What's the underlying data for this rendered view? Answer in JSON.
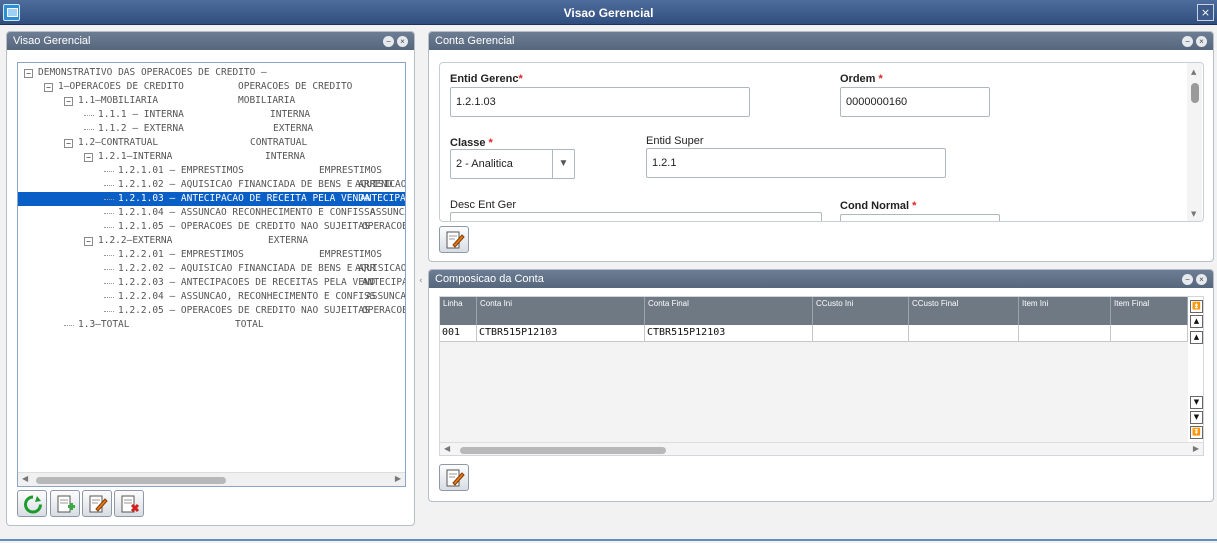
{
  "window": {
    "title": "Visao Gerencial",
    "close_glyph": "×"
  },
  "left_panel": {
    "title": "Visao Gerencial",
    "tree": [
      {
        "label": "DEMONSTRATIVO DAS OPERACOES DE CREDITO –",
        "desc": "",
        "expander": "−"
      },
      {
        "label": "1–OPERACOES DE CREDITO",
        "desc": "OPERACOES DE CREDITO",
        "expander": "−"
      },
      {
        "label": "1.1–MOBILIARIA",
        "desc": "MOBILIARIA",
        "expander": "−"
      },
      {
        "label": "1.1.1 – INTERNA",
        "desc": "INTERNA",
        "expander": ""
      },
      {
        "label": "1.1.2 – EXTERNA",
        "desc": "EXTERNA",
        "expander": ""
      },
      {
        "label": "1.2–CONTRATUAL",
        "desc": "CONTRATUAL",
        "expander": "−"
      },
      {
        "label": "1.2.1–INTERNA",
        "desc": "INTERNA",
        "expander": "−"
      },
      {
        "label": "1.2.1.01 – EMPRESTIMOS",
        "desc": "EMPRESTIMOS",
        "expander": ""
      },
      {
        "label": "1.2.1.02 – AQUISICAO FINANCIADA DE BENS E ARREND",
        "desc": "AQUISICAO",
        "expander": ""
      },
      {
        "label": "1.2.1.03 – ANTECIPACAO DE RECEITA PELA VENDA",
        "desc": "ANTECIPAC",
        "expander": ""
      },
      {
        "label": "1.2.1.04 – ASSUNCAO RECONHECIMENTO E CONFISSA",
        "desc": "ASSUNCAO",
        "expander": ""
      },
      {
        "label": "1.2.1.05 – OPERACOES DE CREDITO NAO SUJEITAS",
        "desc": "OPERACOE",
        "expander": ""
      },
      {
        "label": "1.2.2–EXTERNA",
        "desc": "EXTERNA",
        "expander": "−"
      },
      {
        "label": "1.2.2.01 – EMPRESTIMOS",
        "desc": "EMPRESTIMOS",
        "expander": ""
      },
      {
        "label": "1.2.2.02 – AQUISICAO FINANCIADA DE BENS E ARR",
        "desc": "AQUISICAO I",
        "expander": ""
      },
      {
        "label": "1.2.2.03 – ANTECIPACOES DE RECEITAS PELA VEND",
        "desc": "ANTECIPA",
        "expander": ""
      },
      {
        "label": "1.2.2.04 – ASSUNCAO, RECONHECIMENTO E CONFISS",
        "desc": "ASSUNCA",
        "expander": ""
      },
      {
        "label": "1.2.2.05 – OPERACOES DE CREDITO NAO SUJEITAS",
        "desc": "OPERACOE",
        "expander": ""
      },
      {
        "label": "1.3–TOTAL",
        "desc": "TOTAL",
        "expander": ""
      }
    ],
    "selected_index": 9,
    "toolbar_icons": [
      "refresh-icon",
      "add-icon",
      "edit-icon",
      "delete-icon"
    ]
  },
  "form_panel": {
    "title": "Conta Gerencial",
    "fields": {
      "entid_gerenc": {
        "label": "Entid Gerenc",
        "value": "1.2.1.03",
        "required_mark": "*"
      },
      "ordem": {
        "label": "Ordem",
        "value": "0000000160",
        "required_mark": "*"
      },
      "classe": {
        "label": "Classe",
        "value": "2 - Analitica",
        "required_mark": "*"
      },
      "entid_super": {
        "label": "Entid Super",
        "value": "1.2.1"
      },
      "desc_ent_ger": {
        "label": "Desc Ent Ger",
        "value": ""
      },
      "cond_normal": {
        "label": "Cond Normal",
        "value": "",
        "required_mark": "*"
      }
    }
  },
  "grid_panel": {
    "title": "Composicao da Conta",
    "columns": [
      "Linha",
      "Conta Ini",
      "Conta Final",
      "CCusto Ini",
      "CCusto Final",
      "Item Ini",
      "Item Final"
    ],
    "rows": [
      [
        "001",
        "CTBR515P12103",
        "CTBR515P12103",
        "",
        "",
        "",
        ""
      ]
    ]
  },
  "colors": {
    "accent": "#0a5fc6",
    "titlebar": "#2f4d7e",
    "panel_header": "#56677d"
  }
}
